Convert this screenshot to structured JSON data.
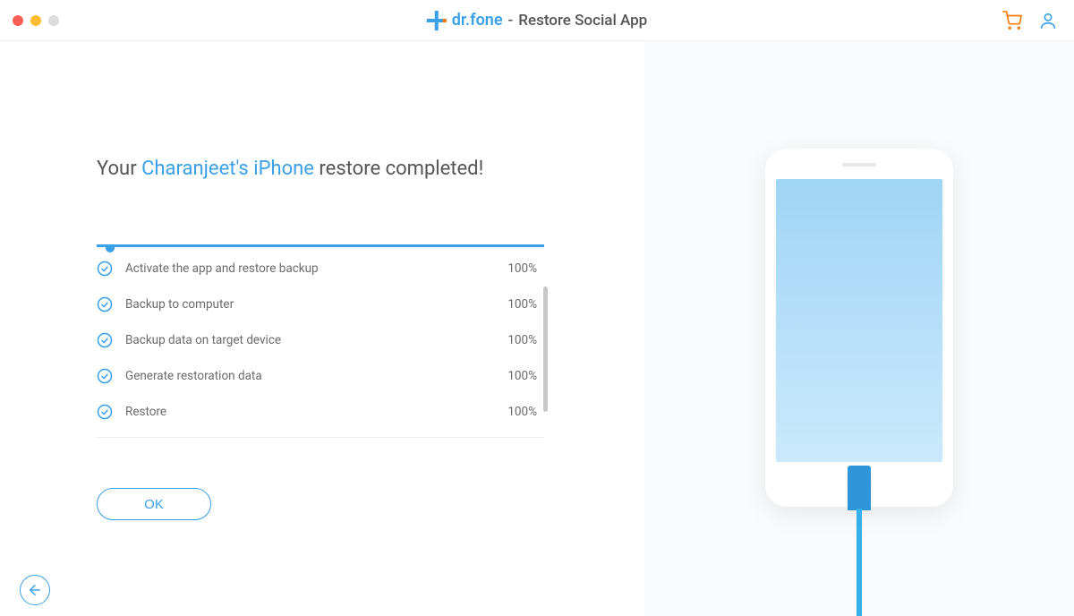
{
  "titlebar": {
    "brand": "dr.fone",
    "separator": "-",
    "subtitle": "Restore Social App"
  },
  "headline": {
    "prefix": "Your ",
    "device": "Charanjeet's iPhone",
    "suffix": " restore completed!"
  },
  "steps": [
    {
      "label": "Activate the app and restore backup",
      "percent": "100%"
    },
    {
      "label": "Backup to computer",
      "percent": "100%"
    },
    {
      "label": "Backup data on target device",
      "percent": "100%"
    },
    {
      "label": "Generate restoration data",
      "percent": "100%"
    },
    {
      "label": "Restore",
      "percent": "100%"
    }
  ],
  "buttons": {
    "ok": "OK"
  },
  "colors": {
    "accent": "#3aa0e8",
    "cart": "#ff7a00"
  }
}
